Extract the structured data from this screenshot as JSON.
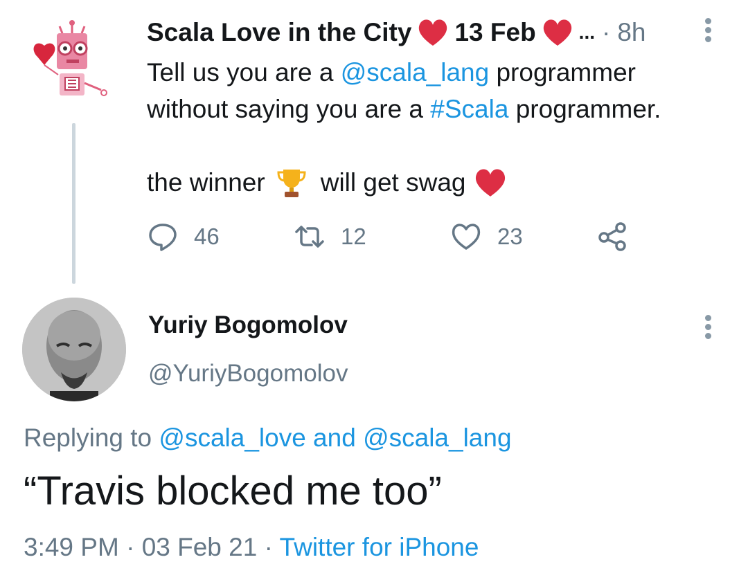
{
  "tweet1": {
    "display_name": "Scala Love in the City",
    "date_label": "13 Feb",
    "ellipsis": "...",
    "separator": "·",
    "time": "8h",
    "body_prefix": "Tell us you are a ",
    "mention": "@scala_lang",
    "body_mid": " programmer\nwithout saying you are a ",
    "hashtag": "#Scala",
    "body_suffix": " programmer.",
    "winner_prefix": "the winner",
    "winner_suffix": "will get swag",
    "replies": "46",
    "retweets": "12",
    "likes": "23",
    "icons": [
      "heart-emoji",
      "trophy-emoji",
      "reply-icon",
      "retweet-icon",
      "like-icon",
      "share-icon",
      "more-icon"
    ]
  },
  "tweet2": {
    "display_name": "Yuriy Bogomolov",
    "handle": "@YuriyBogomolov",
    "replying_prefix": "Replying to ",
    "reply_mention1": "@scala_love",
    "reply_and": " and ",
    "reply_mention2": "@scala_lang",
    "text": "“Travis blocked me too”",
    "time": "3:49 PM",
    "separator": " · ",
    "date": "03 Feb 21",
    "source": "Twitter for iPhone"
  },
  "colors": {
    "link": "#1b95e0",
    "secondary": "#657786",
    "heart": "#dd2e44",
    "thread_line": "#ccd6dd"
  }
}
